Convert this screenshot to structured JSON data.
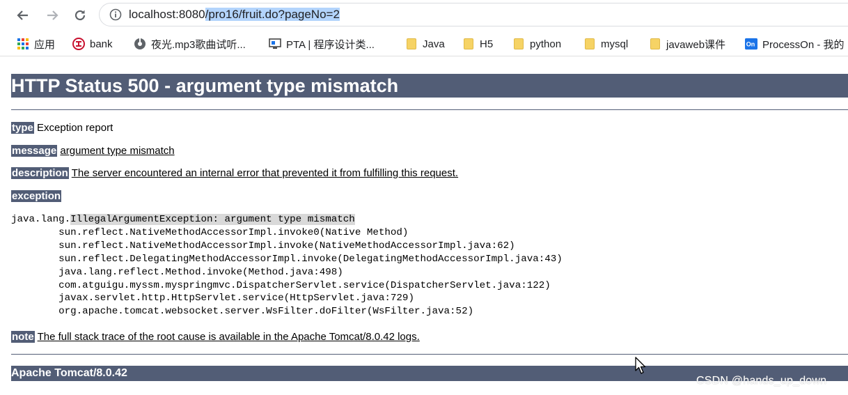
{
  "browser": {
    "url_host": "localhost:8080",
    "url_path": "/pro16/fruit.do?pageNo=2",
    "bookmarks": [
      {
        "label": "应用",
        "icon": "apps-grid-icon"
      },
      {
        "label": "bank",
        "icon": "bank-logo-icon"
      },
      {
        "label": "夜光.mp3歌曲试听...",
        "icon": "music-site-icon"
      },
      {
        "label": "PTA | 程序设计类...",
        "icon": "pta-site-icon"
      },
      {
        "label": "Java",
        "icon": "folder-icon"
      },
      {
        "label": "H5",
        "icon": "folder-icon"
      },
      {
        "label": "python",
        "icon": "folder-icon"
      },
      {
        "label": "mysql",
        "icon": "folder-icon"
      },
      {
        "label": "javaweb课件",
        "icon": "folder-icon"
      },
      {
        "label": "ProcessOn - 我的",
        "icon": "processon-icon"
      }
    ]
  },
  "error_page": {
    "title": "HTTP Status 500 - argument type mismatch",
    "type_label": "type",
    "type_value": "Exception report",
    "message_label": "message",
    "message_value": "argument type mismatch",
    "description_label": "description",
    "description_value": "The server encountered an internal error that prevented it from fulfilling this request.",
    "exception_label": "exception",
    "exception_prefix": "java.lang.",
    "exception_highlight": "IllegalArgumentException: argument type mismatch",
    "stack_trace": [
      "sun.reflect.NativeMethodAccessorImpl.invoke0(Native Method)",
      "sun.reflect.NativeMethodAccessorImpl.invoke(NativeMethodAccessorImpl.java:62)",
      "sun.reflect.DelegatingMethodAccessorImpl.invoke(DelegatingMethodAccessorImpl.java:43)",
      "java.lang.reflect.Method.invoke(Method.java:498)",
      "com.atguigu.myssm.myspringmvc.DispatcherServlet.service(DispatcherServlet.java:122)",
      "javax.servlet.http.HttpServlet.service(HttpServlet.java:729)",
      "org.apache.tomcat.websocket.server.WsFilter.doFilter(WsFilter.java:52)"
    ],
    "note_label": "note",
    "note_value": "The full stack trace of the root cause is available in the Apache Tomcat/8.0.42 logs.",
    "footer": "Apache Tomcat/8.0.42"
  },
  "watermark": "CSDN @hands_up_down",
  "colors": {
    "tomcat_bar": "#525d76",
    "selection": "#b3d4fc"
  }
}
